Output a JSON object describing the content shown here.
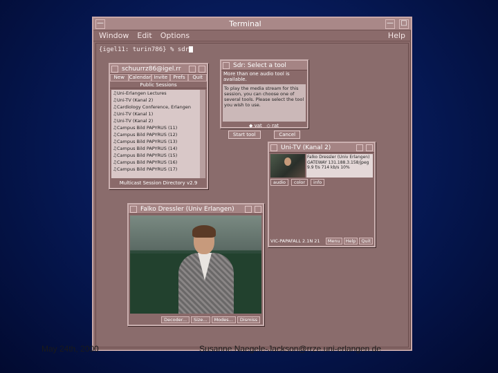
{
  "terminal": {
    "title": "Terminal",
    "menu": [
      "Window",
      "Edit",
      "Options"
    ],
    "help": "Help",
    "prompt": "{igel11: turin786} % sdr"
  },
  "sessions": {
    "title": "schuurrz86@igel.rr",
    "tabs": [
      "New",
      "Calendar",
      "Invite",
      "Prefs",
      "Quit"
    ],
    "header": "Public Sessions",
    "items": [
      "Uni-Erlangen Lectures",
      "Uni-TV (Kanal 2)",
      "Cardiology Conference, Erlangen",
      "Uni-TV (Kanal 1)",
      "Uni-TV (Kanal 2)",
      "Campus Bild PAPYRUS (11)",
      "Campus Bild PAPYRUS (12)",
      "Campus Bild PAPYRUS (13)",
      "Campus Bild PAPYRUS (14)",
      "Campus Bild PAPYRUS (15)",
      "Campus Bild PAPYRUS (16)",
      "Campus Bild PAPYRUS (17)"
    ],
    "footer": "Multicast Session Directory v2.9"
  },
  "select_tool": {
    "title": "Sdr: Select a tool",
    "header": "More than one audio tool is available.",
    "body": "To play the media stream for this session, you can choose one of several tools. Please select the tool you wish to use.",
    "options": [
      "vat",
      "rat"
    ],
    "buttons": [
      "Start tool",
      "Cancel"
    ]
  },
  "unitv": {
    "title": "Uni-TV (Kanal 2)",
    "desc": "Falko Dressler (Univ Erlangen) GATEWAY 131.188.3.158/jpeg 9.9 f/s 714 kb/s 10%",
    "options": [
      "audio",
      "color",
      "info"
    ],
    "status": "VIC-PAPAFALL 2.1N 21",
    "buttons": [
      "Menu",
      "Help",
      "Quit"
    ]
  },
  "video": {
    "title": "Falko Dressler (Univ Erlangen)",
    "buttons": [
      "Decoder...",
      "Size...",
      "Modes...",
      "Dismiss"
    ]
  },
  "footer": {
    "date": "May 24th, 2000",
    "email": "Susanne.Naegele-Jackson@rrze.uni-erlangen.de"
  }
}
